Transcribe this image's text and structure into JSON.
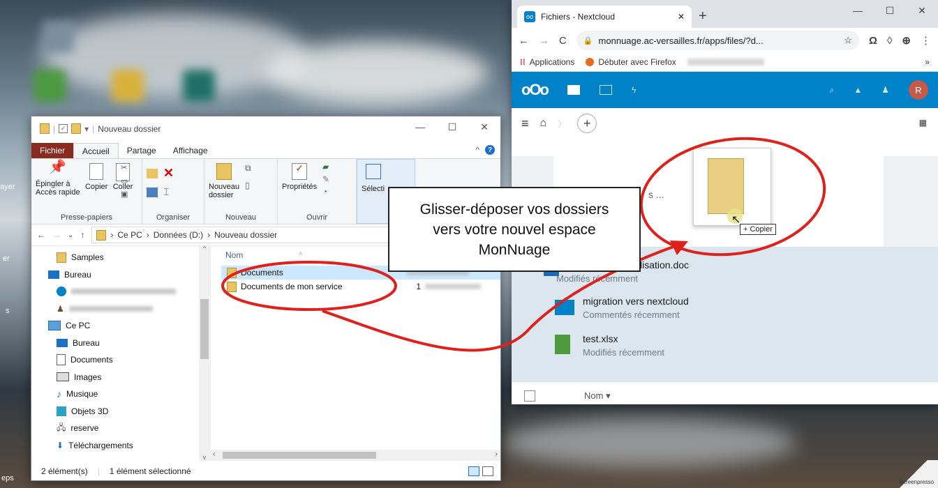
{
  "explorer": {
    "title": "Nouveau dossier",
    "tabs": [
      "Fichier",
      "Accueil",
      "Partage",
      "Affichage"
    ],
    "ribbon": {
      "presse_papiers": {
        "label": "Presse-papiers",
        "pin": "Épingler à\nAccès rapide",
        "copy": "Copier",
        "paste": "Coller"
      },
      "organiser": {
        "label": "Organiser"
      },
      "nouveau": {
        "label": "Nouveau",
        "new_folder": "Nouveau\ndossier"
      },
      "ouvrir": {
        "label": "Ouvrir",
        "properties": "Propriétés"
      },
      "selection": "Sélecti"
    },
    "address": {
      "segments": [
        "Ce PC",
        "Données (D:)",
        "Nouveau dossier"
      ]
    },
    "nav_items": [
      "Samples",
      "Bureau",
      "Ce PC",
      "Bureau",
      "Documents",
      "Images",
      "Musique",
      "Objets 3D",
      "reserve",
      "Téléchargements"
    ],
    "column_name": "Nom",
    "files": [
      {
        "name": "Documents",
        "date": ""
      },
      {
        "name": "Documents de mon service",
        "date": "1"
      }
    ],
    "status": {
      "count": "2 élément(s)",
      "selected": "1 élément sélectionné"
    }
  },
  "browser": {
    "tab_title": "Fichiers - Nextcloud",
    "url": "monnuage.ac-versailles.fr/apps/files/?d...",
    "bookmarks": [
      "Applications",
      "Débuter avec Firefox"
    ],
    "avatar_initial": "R",
    "recent_partial": "s ...",
    "recent": [
      {
        "name": "lisation.doc",
        "sub": "Modifiés récemment"
      },
      {
        "name": "migration vers nextcloud",
        "sub": "Commentés récemment"
      },
      {
        "name": "test.xlsx",
        "sub": "Modifiés récemment"
      }
    ],
    "footer_col": "Nom",
    "copy_tooltip": "+ Copier"
  },
  "callout": {
    "text": "Glisser-déposer vos dossiers vers votre nouvel espace MonNuage"
  },
  "desktop_labels": [
    "ayer",
    "er",
    "s",
    "eps"
  ],
  "watermark": "Screenpresso",
  "colors": {
    "nextcloud_blue": "#0082c9",
    "annotation_red": "#e0201b",
    "selection_blue": "#cce8ff"
  }
}
